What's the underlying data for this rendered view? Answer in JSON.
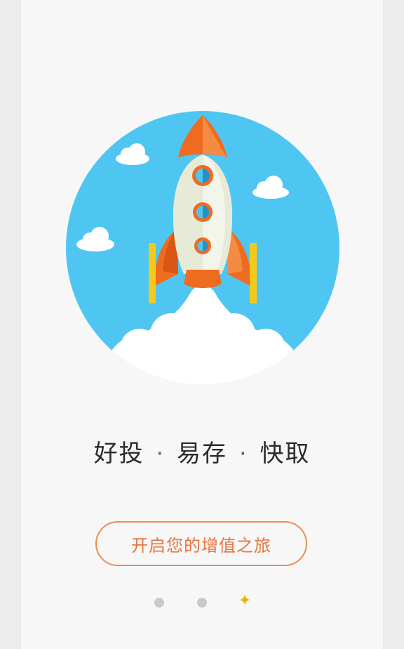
{
  "tagline": {
    "part1": "好投",
    "sep": "·",
    "part2": "易存",
    "part3": "快取"
  },
  "cta": {
    "label": "开启您的增值之旅"
  },
  "pager": {
    "total": 3,
    "current": 3,
    "active_icon": "star-icon",
    "active_glyph": "✦"
  },
  "colors": {
    "sky": "#4ec6f1",
    "rocket_orange": "#ef6b1f",
    "rocket_body": "#eef0e3",
    "fin_yellow": "#f5c91b",
    "cta_orange": "#e8743d",
    "active_dot": "#f3b000"
  }
}
